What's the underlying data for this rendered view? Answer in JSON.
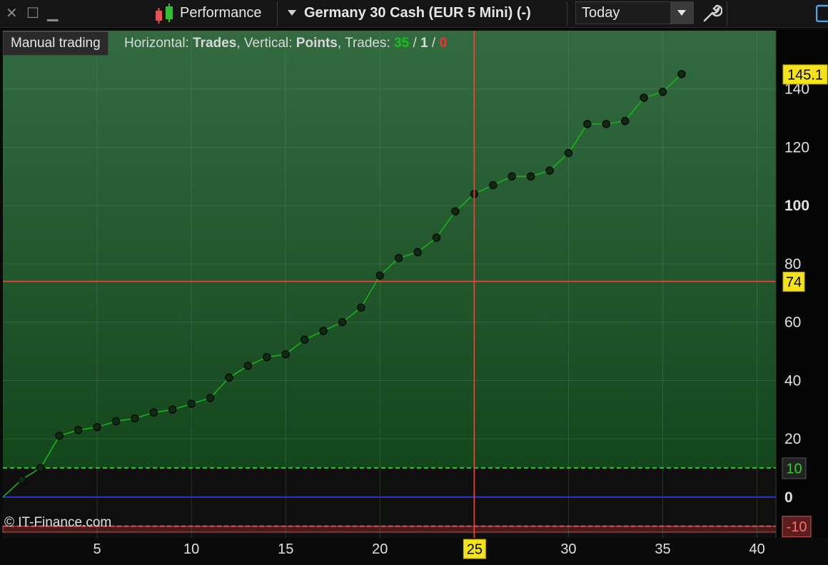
{
  "toolbar": {
    "chart_type_label": "Performance",
    "instrument_label": "Germany 30 Cash (EUR 5 Mini) (-)",
    "period_value": "Today"
  },
  "header": {
    "manual_trading_label": "Manual trading",
    "horizontal_prefix": "Horizontal: ",
    "horizontal_value": "Trades",
    "vertical_prefix": ", Vertical: ",
    "vertical_value": "Points",
    "trades_prefix": ", Trades: ",
    "trades_win": "35",
    "slash1": " / ",
    "trades_neutral": "1",
    "slash2": " / ",
    "trades_loss": "0"
  },
  "footer": {
    "copyright": "© IT-Finance.com"
  },
  "colors": {
    "profit_zone_top": "#336b40",
    "profit_zone_bottom": "#14461c",
    "line": "#17b317",
    "crosshair": "#e84a3a",
    "zero_line": "#3232c8",
    "label_yellow": "#f4e21a"
  },
  "chart_data": {
    "type": "line",
    "x": [
      0,
      1,
      2,
      3,
      4,
      5,
      6,
      7,
      8,
      9,
      10,
      11,
      12,
      13,
      14,
      15,
      16,
      17,
      18,
      19,
      20,
      21,
      22,
      23,
      24,
      25,
      26,
      27,
      28,
      29,
      30,
      31,
      32,
      33,
      34,
      35,
      36
    ],
    "y": [
      0,
      6,
      10,
      21,
      23,
      24,
      26,
      27,
      29,
      30,
      32,
      34,
      41,
      45,
      48,
      49,
      54,
      57,
      60,
      65,
      76,
      82,
      84,
      89,
      98,
      104,
      107,
      110,
      110,
      112,
      118,
      128,
      128,
      129,
      137,
      139,
      145.1
    ],
    "xlim": [
      0,
      41
    ],
    "ylim": [
      -14,
      160
    ],
    "xticks": [
      "5",
      "10",
      "15",
      "20",
      "25",
      "30",
      "35",
      "40"
    ],
    "xtick_values": [
      5,
      10,
      15,
      20,
      25,
      30,
      35,
      40
    ],
    "yticks": [
      "20",
      "40",
      "60",
      "80",
      "100",
      "120",
      "140"
    ],
    "ytick_values": [
      20,
      40,
      60,
      80,
      100,
      120,
      140
    ],
    "zero_label": "0",
    "upper_threshold": 10,
    "upper_threshold_label": "10",
    "lower_threshold": -10,
    "lower_threshold_label": "-10",
    "last_value_label": "145.1",
    "last_value": 145.1,
    "crosshair_x": 25,
    "crosshair_x_label": "25",
    "crosshair_y": 74,
    "crosshair_y_label": "74",
    "grid": true
  }
}
